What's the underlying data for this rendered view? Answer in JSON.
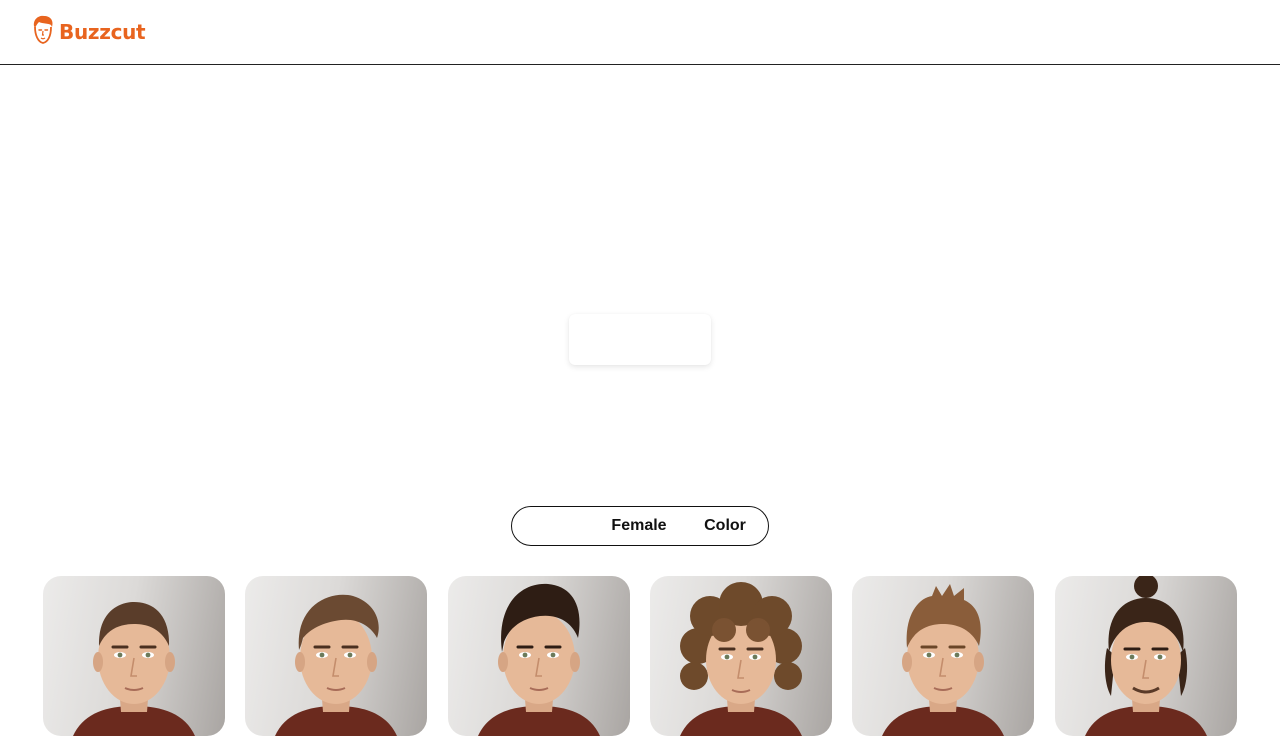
{
  "brand": {
    "name": "Buzzcut",
    "color": "#e8641f",
    "icon": "face-logo-icon"
  },
  "filter": {
    "options": [
      {
        "label": "",
        "active": true
      },
      {
        "label": "Female",
        "active": false
      },
      {
        "label": "Color",
        "active": false
      }
    ]
  },
  "hairstyles": [
    {
      "style": "buzz",
      "hair_color": "#5a3d2a",
      "icon": "buzzcut-portrait"
    },
    {
      "style": "side-swept",
      "hair_color": "#6b4a32",
      "icon": "side-swept-portrait"
    },
    {
      "style": "pompadour",
      "hair_color": "#2e1d14",
      "icon": "pompadour-portrait"
    },
    {
      "style": "curly",
      "hair_color": "#6e4a2b",
      "icon": "curly-portrait"
    },
    {
      "style": "textured-crop",
      "hair_color": "#8a5d3a",
      "icon": "textured-crop-portrait"
    },
    {
      "style": "man-bun",
      "hair_color": "#3a2518",
      "icon": "man-bun-portrait"
    }
  ]
}
